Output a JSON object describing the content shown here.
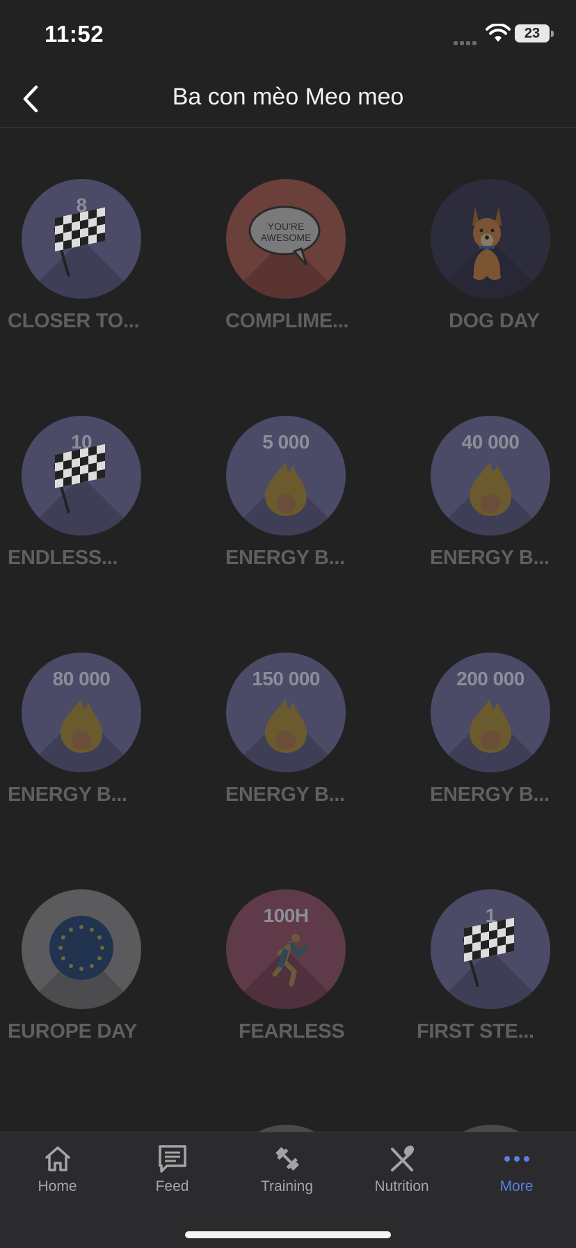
{
  "status_bar": {
    "time": "11:52",
    "battery": "23"
  },
  "nav": {
    "title": "Ba con mèo Meo meo"
  },
  "badges": [
    {
      "number": "8",
      "label": "CLOSER TO...",
      "icon": "checkered-flag-icon",
      "color": "#4b4a67"
    },
    {
      "number": "",
      "label": "COMPLIME...",
      "icon": "speech-bubble-icon",
      "bubble_text_1": "YOU'RE",
      "bubble_text_2": "AWESOME",
      "color": "#6b3f3a"
    },
    {
      "number": "",
      "label": "DOG DAY",
      "icon": "dog-icon",
      "color": "#2d2c3c"
    },
    {
      "number": "10",
      "label": "ENDLESS...",
      "icon": "checkered-flag-icon",
      "color": "#4b4a67"
    },
    {
      "number": "5 000",
      "label": "ENERGY B...",
      "icon": "flame-icon",
      "color": "#4b4a67"
    },
    {
      "number": "40 000",
      "label": "ENERGY B...",
      "icon": "flame-icon",
      "color": "#4b4a67"
    },
    {
      "number": "80 000",
      "label": "ENERGY B...",
      "icon": "flame-icon",
      "color": "#4b4a67"
    },
    {
      "number": "150 000",
      "label": "ENERGY B...",
      "icon": "flame-icon",
      "color": "#4b4a67"
    },
    {
      "number": "200 000",
      "label": "ENERGY B...",
      "icon": "flame-icon",
      "color": "#4b4a67"
    },
    {
      "number": "",
      "label": "EUROPE DAY",
      "icon": "eu-flag-icon",
      "color": "#5b5b5d"
    },
    {
      "number": "100H",
      "label": "FEARLESS",
      "icon": "runner-icon",
      "color": "#5f3a48"
    },
    {
      "number": "1",
      "label": "FIRST STE...",
      "icon": "checkered-flag-icon",
      "color": "#4b4a67"
    }
  ],
  "tabs": [
    {
      "label": "Home",
      "icon": "home-icon"
    },
    {
      "label": "Feed",
      "icon": "feed-icon"
    },
    {
      "label": "Training",
      "icon": "dumbbell-icon"
    },
    {
      "label": "Nutrition",
      "icon": "fork-spoon-icon"
    },
    {
      "label": "More",
      "icon": "more-dots-icon",
      "active": true
    }
  ],
  "colors": {
    "accent": "#5b7ee8",
    "background": "#222223"
  }
}
